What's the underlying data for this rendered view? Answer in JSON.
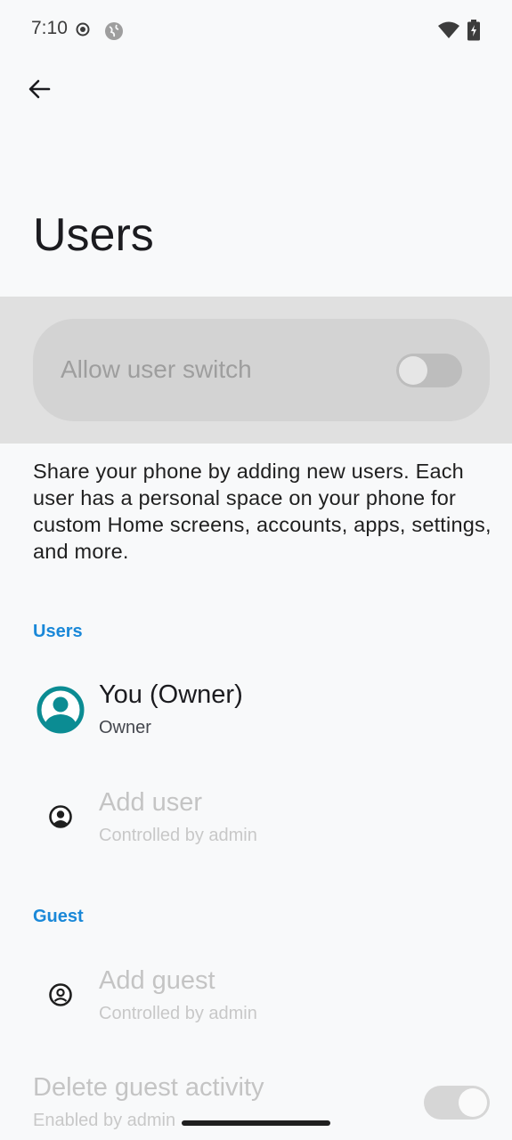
{
  "status_bar": {
    "time": "7:10",
    "icons": [
      "record-icon",
      "globe-icon",
      "wifi-icon",
      "battery-charging-icon"
    ]
  },
  "header": {
    "back_icon": "arrow-back-icon",
    "title": "Users"
  },
  "allow_switch": {
    "label": "Allow user switch",
    "enabled": false,
    "checked": false
  },
  "description": "Share your phone by adding new users. Each user has a personal space on your phone for custom Home screens, accounts, apps, settings, and more.",
  "users_section": {
    "header": "Users",
    "owner": {
      "title": "You (Owner)",
      "subtitle": "Owner"
    },
    "add_user": {
      "title": "Add user",
      "subtitle": "Controlled by admin"
    }
  },
  "guest_section": {
    "header": "Guest",
    "add_guest": {
      "title": "Add guest",
      "subtitle": "Controlled by admin"
    },
    "delete_guest_activity": {
      "title": "Delete guest activity",
      "subtitle": "Enabled by admin",
      "checked": true
    }
  },
  "colors": {
    "accent": "#1a88d8",
    "avatar": "#0b8c93",
    "background": "#f8f9fa"
  }
}
